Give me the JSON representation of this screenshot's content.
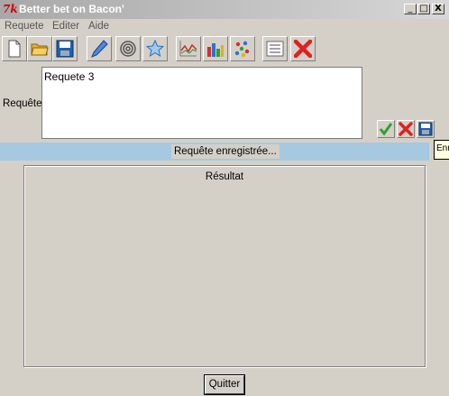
{
  "window": {
    "title": "Better bet on Bacon'",
    "logo": "7k"
  },
  "window_controls": {
    "minimize": "_",
    "maximize": "□",
    "close": "X"
  },
  "menu": [
    "Requete",
    "Editer",
    "Aide"
  ],
  "toolbar": [
    {
      "icon": "new-document-icon"
    },
    {
      "icon": "open-folder-icon"
    },
    {
      "icon": "save-icon"
    },
    {
      "icon": "pen-icon"
    },
    {
      "icon": "spiral-icon"
    },
    {
      "icon": "star-icon"
    },
    {
      "icon": "line-chart-icon"
    },
    {
      "icon": "bar-chart-icon"
    },
    {
      "icon": "scatter-chart-icon"
    },
    {
      "icon": "list-icon"
    },
    {
      "icon": "close-red-x-icon"
    }
  ],
  "query": {
    "label": "Requête",
    "value": "Requete 3"
  },
  "status": {
    "text": "Requête enregistrée..."
  },
  "tooltip": {
    "text": "Enregistrer"
  },
  "result": {
    "label": "Résultat"
  },
  "quit_button": {
    "label": "Quitter"
  },
  "colors": {
    "status_bar": "#a6c8e0",
    "background": "#d4d0c8"
  }
}
